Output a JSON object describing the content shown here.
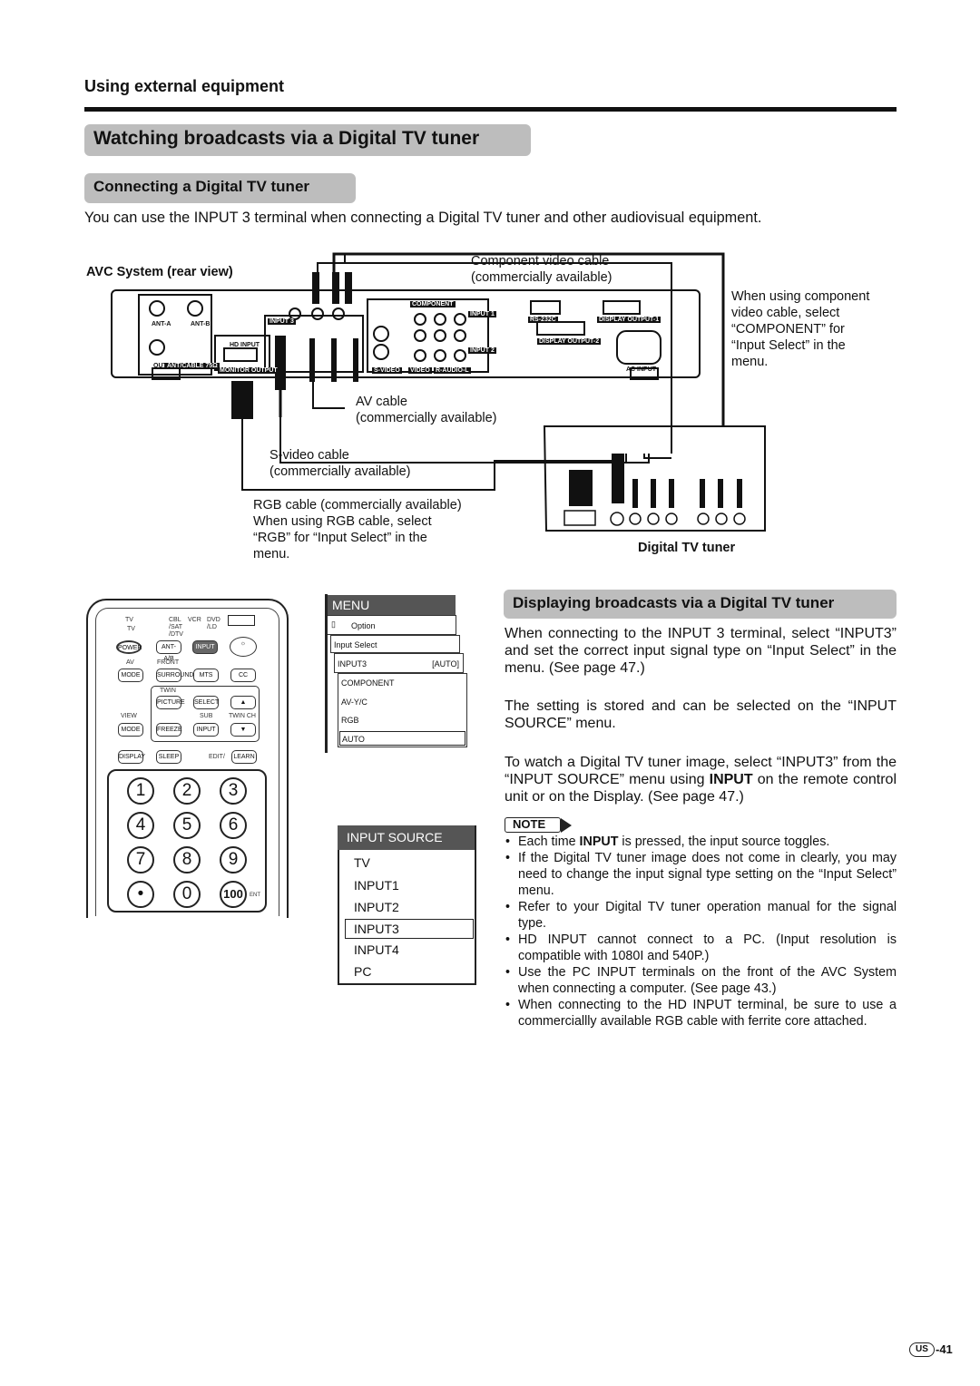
{
  "section": "Using external equipment",
  "title": "Watching broadcasts via a Digital TV tuner",
  "connect": {
    "heading": "Connecting a Digital TV tuner",
    "intro": "You can use the INPUT 3 terminal when connecting a Digital TV tuner and other audiovisual equipment."
  },
  "diagram": {
    "avc_label": "AVC System (rear view)",
    "component_cable": [
      "Component video cable",
      "(commercially available)"
    ],
    "component_note": [
      "When using component",
      "video cable, select",
      "“COMPONENT” for",
      "“Input Select” in the",
      "menu."
    ],
    "av_cable": [
      "AV cable",
      "(commercially available)"
    ],
    "svideo_cable": [
      "S-video cable",
      "(commercially available)"
    ],
    "rgb_note": [
      "RGB cable (commercially available)",
      "When using RGB cable, select",
      "“RGB” for “Input Select” in the",
      "menu."
    ],
    "tuner_label": "Digital TV tuner",
    "panel": {
      "ant_a": "ANT-A",
      "ant_b": "ANT-B",
      "out": "OUT",
      "ant_cable": "ANT/CABLE 75Ω",
      "hd_input": "HD INPUT",
      "monitor_output": "MONITOR OUTPUT",
      "input3": "INPUT 3",
      "component": "COMPONENT",
      "input1": "INPUT 1",
      "input2": "INPUT 2",
      "svideo": "S-VIDEO",
      "video": "VIDEO",
      "audio": "R-AUDIO-L",
      "rs232c": "RS-232C",
      "display_output1": "DISPLAY OUTPUT-1",
      "display_output2": "DISPLAY OUTPUT-2",
      "ac_input": "AC INPUT",
      "y": "Y",
      "pb": "PB",
      "pr": "PR"
    }
  },
  "remote": {
    "modes": [
      "TV",
      "CBL /SAT /DTV",
      "VCR",
      "DVD /LD"
    ],
    "tv": "TV",
    "power": "POWER",
    "ant": "ANT-A/B",
    "input": "INPUT",
    "av": "AV",
    "mode": "MODE",
    "front": "FRONT",
    "surround": "SURROUND",
    "mts": "MTS",
    "cc": "CC",
    "twin": "TWIN",
    "picture": "PICTURE",
    "select": "SELECT",
    "view": "VIEW",
    "sub": "SUB",
    "twinch": "TWIN CH",
    "freeze": "FREEZE",
    "subinput": "INPUT",
    "display": "DISPLAY",
    "sleep": "SLEEP",
    "edit": "EDIT/",
    "learn": "LEARN",
    "digits": [
      "1",
      "2",
      "3",
      "4",
      "5",
      "6",
      "7",
      "8",
      "9",
      "•",
      "0",
      "100"
    ],
    "ent": "ENT"
  },
  "menu": {
    "title": "MENU",
    "option": "Option",
    "input_select": "Input Select",
    "input3": "INPUT3",
    "input3_value": "[AUTO]",
    "options": [
      "COMPONENT",
      "AV-Y/C",
      "RGB",
      "AUTO"
    ],
    "selected": "AUTO"
  },
  "input_source": {
    "title": "INPUT SOURCE",
    "items": [
      "TV",
      "INPUT1",
      "INPUT2",
      "INPUT3",
      "INPUT4",
      "PC"
    ],
    "selected": "INPUT3"
  },
  "display": {
    "heading": "Displaying broadcasts via a Digital TV tuner",
    "p1": "When connecting to the INPUT 3 terminal, select “INPUT3” and set the correct input signal type on “Input Select” in the menu. (See page 47.)",
    "p2": "The setting is stored and can be selected on the “INPUT SOURCE” menu.",
    "p3a": "To watch a Digital TV tuner image, select “INPUT3” from the “INPUT SOURCE” menu using ",
    "p3b": "INPUT",
    "p3c": " on the remote control unit or on the Display. (See page 47.)",
    "note_label": "NOTE",
    "notes": [
      {
        "a": "Each time ",
        "b": "INPUT",
        "c": " is pressed, the input source toggles."
      },
      {
        "a": "If the Digital TV tuner image does not come in clearly, you may need to change the input signal type setting on the “Input Select” menu."
      },
      {
        "a": "Refer to your Digital TV tuner operation manual for the signal type."
      },
      {
        "a": "HD INPUT cannot connect to a PC. (Input resolution is compatible with 1080I and 540P.)"
      },
      {
        "a": "Use the PC INPUT terminals on the front of the AVC System when connecting a computer. (See page 43.)"
      },
      {
        "a": "When connecting to the HD INPUT terminal, be sure to use a commerciallly available RGB cable with ferrite core attached."
      }
    ]
  },
  "footer": {
    "region": "US",
    "page": "-41"
  }
}
